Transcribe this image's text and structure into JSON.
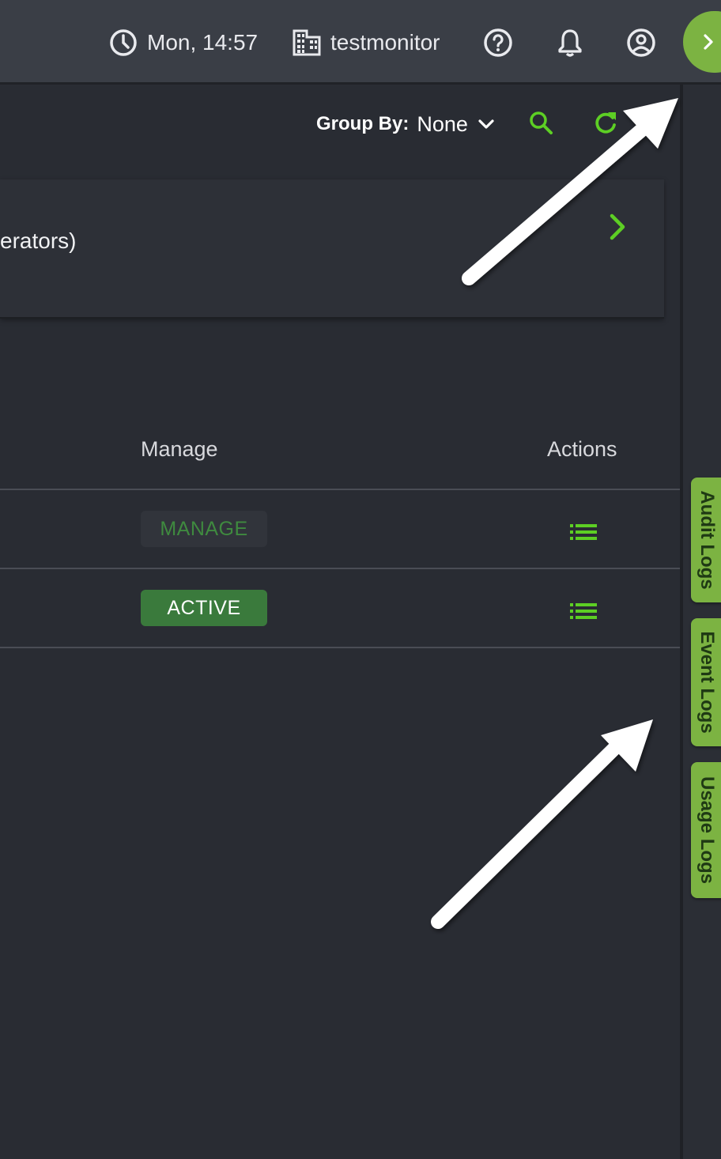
{
  "topbar": {
    "time": "Mon, 14:57",
    "org": "testmonitor"
  },
  "toolbar": {
    "group_by_label": "Group By:",
    "group_by_value": "None"
  },
  "card": {
    "text": "erators)"
  },
  "table": {
    "headers": [
      "Manage",
      "Actions"
    ],
    "rows": [
      {
        "manage": "MANAGE"
      },
      {
        "manage": "ACTIVE"
      }
    ]
  },
  "side_tabs": [
    "Audit Logs",
    "Event Logs",
    "Usage Logs"
  ],
  "colors": {
    "accent_green": "#7cb342",
    "icon_green": "#5dcf24",
    "active_badge": "#3a7a3c",
    "background": "#292c33",
    "topbar": "#3a3e46"
  }
}
